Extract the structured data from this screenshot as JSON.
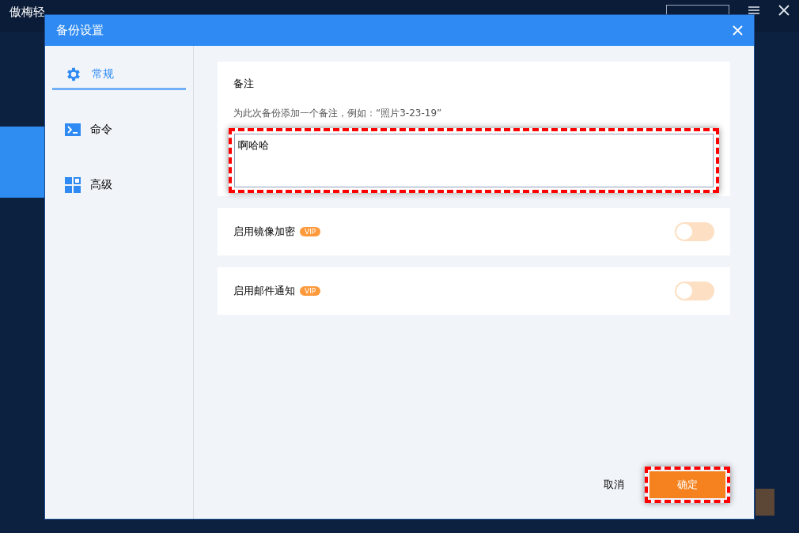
{
  "app": {
    "title": "傲梅轻"
  },
  "dialog": {
    "title": "备份设置",
    "nav": [
      {
        "kind": "gear",
        "label": "常规",
        "selected": true
      },
      {
        "kind": "terminal",
        "label": "命令",
        "selected": false
      },
      {
        "kind": "grid",
        "label": "高级",
        "selected": false
      }
    ],
    "note": {
      "heading": "备注",
      "hint": "为此次备份添加一个备注，例如：“照片3-23-19”",
      "value": "啊哈哈"
    },
    "options": [
      {
        "label": "启用镜像加密",
        "badge": "VIP",
        "on": false
      },
      {
        "label": "启用邮件通知",
        "badge": "VIP",
        "on": false
      }
    ],
    "cancel": "取消",
    "ok": "确定"
  }
}
